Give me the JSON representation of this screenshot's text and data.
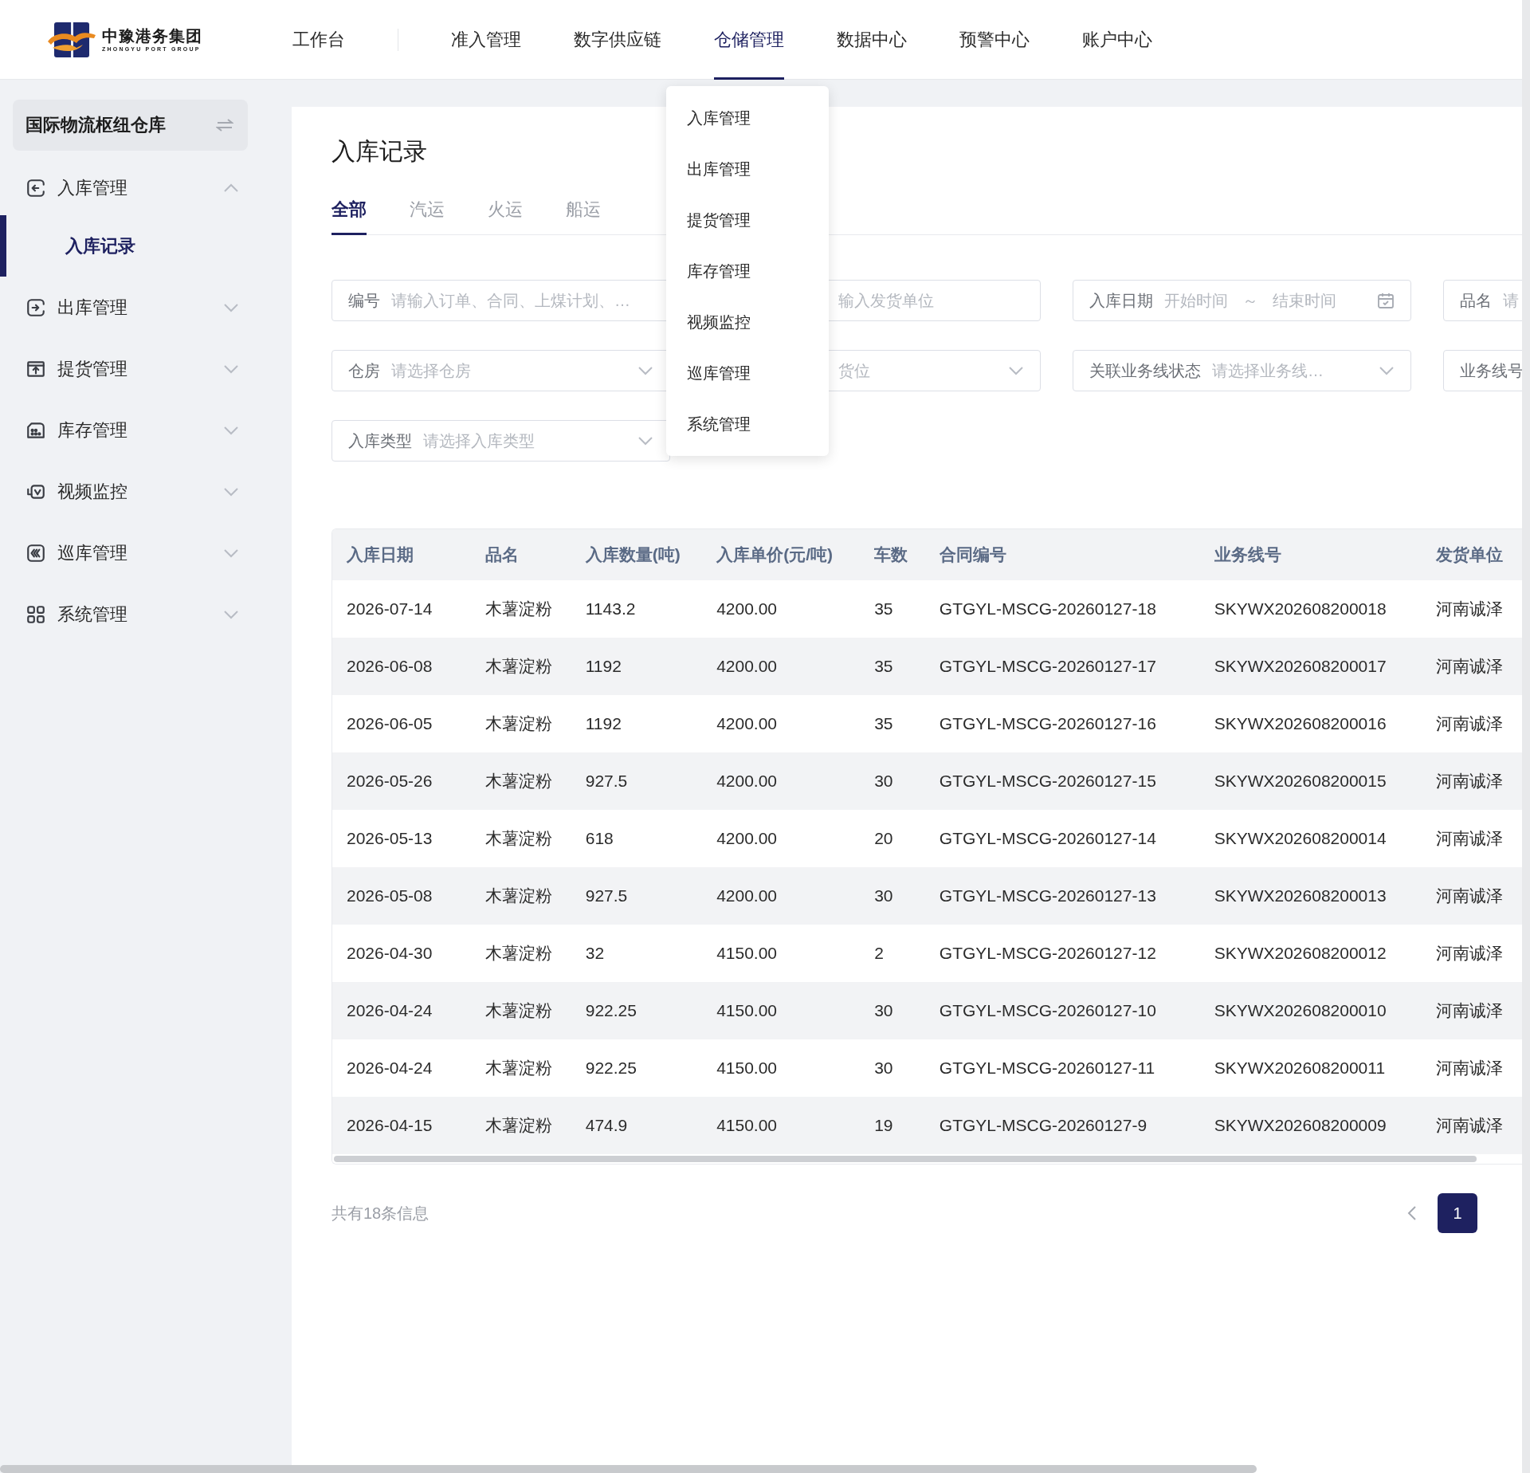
{
  "header": {
    "logo": {
      "name": "中豫港务集团",
      "subtitle": "ZHONGYU PORT GROUP"
    },
    "nav": [
      {
        "label": "工作台",
        "selected": false
      },
      {
        "label": "准入管理",
        "selected": false
      },
      {
        "label": "数字供应链",
        "selected": false
      },
      {
        "label": "仓储管理",
        "selected": true
      },
      {
        "label": "数据中心",
        "selected": false
      },
      {
        "label": "预警中心",
        "selected": false
      },
      {
        "label": "账户中心",
        "selected": false
      }
    ]
  },
  "nav_dropdown": {
    "items": [
      "入库管理",
      "出库管理",
      "提货管理",
      "库存管理",
      "视频监控",
      "巡库管理",
      "系统管理"
    ]
  },
  "sidebar": {
    "warehouse": "国际物流枢纽仓库",
    "items": [
      {
        "label": "入库管理",
        "expanded": true,
        "children": [
          {
            "label": "入库记录",
            "selected": true
          }
        ]
      },
      {
        "label": "出库管理",
        "expanded": false
      },
      {
        "label": "提货管理",
        "expanded": false
      },
      {
        "label": "库存管理",
        "expanded": false
      },
      {
        "label": "视频监控",
        "expanded": false
      },
      {
        "label": "巡库管理",
        "expanded": false
      },
      {
        "label": "系统管理",
        "expanded": false
      }
    ]
  },
  "page": {
    "title": "入库记录",
    "tabs": [
      {
        "label": "全部",
        "selected": true
      },
      {
        "label": "汽运",
        "selected": false
      },
      {
        "label": "火运",
        "selected": false
      },
      {
        "label": "船运",
        "selected": false
      }
    ],
    "filters": [
      {
        "kind": "input",
        "label": "编号",
        "placeholder": "请输入订单、合同、上煤计划、…"
      },
      {
        "kind": "input",
        "placeholder": "输入发货单位"
      },
      {
        "kind": "daterange",
        "label": "入库日期",
        "start": "开始时间",
        "separator": "～",
        "end": "结束时间"
      },
      {
        "kind": "input",
        "label": "品名",
        "placeholder": "请"
      },
      {
        "kind": "select",
        "label": "仓房",
        "placeholder": "请选择仓房"
      },
      {
        "kind": "select",
        "placeholder": "货位"
      },
      {
        "kind": "select",
        "label": "关联业务线状态",
        "placeholder": "请选择业务线…"
      },
      {
        "kind": "input",
        "label": "业务线号"
      },
      {
        "kind": "select",
        "label": "入库类型",
        "placeholder": "请选择入库类型"
      }
    ],
    "table": {
      "columns": [
        "入库日期",
        "品名",
        "入库数量(吨)",
        "入库单价(元/吨)",
        "车数",
        "合同编号",
        "业务线号",
        "发货单位"
      ],
      "rows": [
        [
          "2026-07-14",
          "木薯淀粉",
          "1143.2",
          "4200.00",
          "35",
          "GTGYL-MSCG-20260127-18",
          "SKYWX202608200018",
          "河南诚泽"
        ],
        [
          "2026-06-08",
          "木薯淀粉",
          "1192",
          "4200.00",
          "35",
          "GTGYL-MSCG-20260127-17",
          "SKYWX202608200017",
          "河南诚泽"
        ],
        [
          "2026-06-05",
          "木薯淀粉",
          "1192",
          "4200.00",
          "35",
          "GTGYL-MSCG-20260127-16",
          "SKYWX202608200016",
          "河南诚泽"
        ],
        [
          "2026-05-26",
          "木薯淀粉",
          "927.5",
          "4200.00",
          "30",
          "GTGYL-MSCG-20260127-15",
          "SKYWX202608200015",
          "河南诚泽"
        ],
        [
          "2026-05-13",
          "木薯淀粉",
          "618",
          "4200.00",
          "20",
          "GTGYL-MSCG-20260127-14",
          "SKYWX202608200014",
          "河南诚泽"
        ],
        [
          "2026-05-08",
          "木薯淀粉",
          "927.5",
          "4200.00",
          "30",
          "GTGYL-MSCG-20260127-13",
          "SKYWX202608200013",
          "河南诚泽"
        ],
        [
          "2026-04-30",
          "木薯淀粉",
          "32",
          "4150.00",
          "2",
          "GTGYL-MSCG-20260127-12",
          "SKYWX202608200012",
          "河南诚泽"
        ],
        [
          "2026-04-24",
          "木薯淀粉",
          "922.25",
          "4150.00",
          "30",
          "GTGYL-MSCG-20260127-10",
          "SKYWX202608200010",
          "河南诚泽"
        ],
        [
          "2026-04-24",
          "木薯淀粉",
          "922.25",
          "4150.00",
          "30",
          "GTGYL-MSCG-20260127-11",
          "SKYWX202608200011",
          "河南诚泽"
        ],
        [
          "2026-04-15",
          "木薯淀粉",
          "474.9",
          "4150.00",
          "19",
          "GTGYL-MSCG-20260127-9",
          "SKYWX202608200009",
          "河南诚泽"
        ]
      ]
    },
    "pagination": {
      "summary": "共有18条信息",
      "pages": [
        {
          "label": "1",
          "selected": true
        }
      ]
    }
  }
}
